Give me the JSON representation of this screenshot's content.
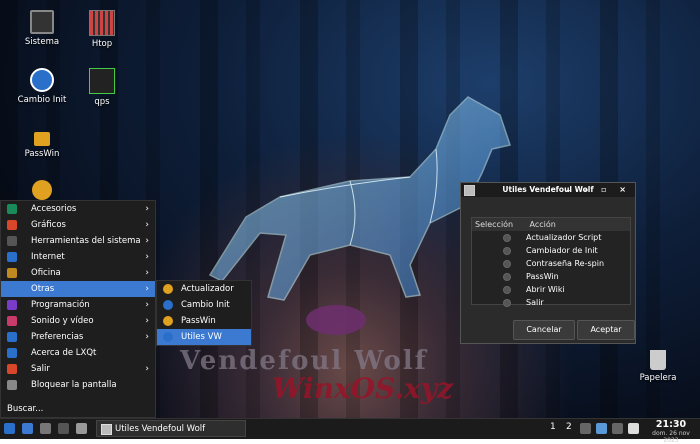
{
  "desktop": {
    "icons": [
      {
        "label": "Sistema",
        "icon": "monitor-icon"
      },
      {
        "label": "Htop",
        "icon": "htop-icon"
      },
      {
        "label": "Cambio Init",
        "icon": "init-icon"
      },
      {
        "label": "qps",
        "icon": "qps-icon"
      },
      {
        "label": "PassWin",
        "icon": "lock-icon"
      },
      {
        "label": "Papelera",
        "icon": "trash-icon"
      }
    ],
    "wallpaper": {
      "title": "Vendefoul Wolf",
      "subtitle": "WinxOS.xyz"
    }
  },
  "start_menu": {
    "items": [
      {
        "label": "Accesorios",
        "submenu": true
      },
      {
        "label": "Gráficos",
        "submenu": true
      },
      {
        "label": "Herramientas del sistema",
        "submenu": true
      },
      {
        "label": "Internet",
        "submenu": true
      },
      {
        "label": "Oficina",
        "submenu": true
      },
      {
        "label": "Otras",
        "submenu": true
      },
      {
        "label": "Programación",
        "submenu": true
      },
      {
        "label": "Sonido y vídeo",
        "submenu": true
      },
      {
        "label": "Preferencias",
        "submenu": true
      },
      {
        "label": "Acerca de LXQt",
        "submenu": false
      },
      {
        "label": "Salir",
        "submenu": true
      },
      {
        "label": "Bloquear la pantalla",
        "submenu": false
      }
    ],
    "selected": "Otras",
    "search_label": "Buscar...",
    "arrow": "›"
  },
  "submenu": {
    "items": [
      {
        "label": "Actualizador"
      },
      {
        "label": "Cambio Init"
      },
      {
        "label": "PassWin"
      },
      {
        "label": "Utiles VW"
      }
    ],
    "selected": "Utiles VW"
  },
  "dialog": {
    "title": "Utiles Vendefoul Wolf",
    "window_buttons": "⌄ – ▫ ×",
    "columns": [
      "Selección",
      "Acción"
    ],
    "rows": [
      "Actualizador Script",
      "Cambiador de Init",
      "Contraseña Re-spin",
      "PassWin",
      "Abrir Wiki",
      "Salir"
    ],
    "cancel_label": "Cancelar",
    "accept_label": "Aceptar"
  },
  "taskbar": {
    "task_label": "Utiles Vendefoul Wolf",
    "workspaces": [
      "1",
      "2"
    ],
    "time": "21:30",
    "date": "dom. 26 nov 2023"
  },
  "colors": {
    "selection": "#3b7ad0",
    "menu_bg": "#1e1e1e",
    "panel_bg": "#1b1b1b"
  }
}
